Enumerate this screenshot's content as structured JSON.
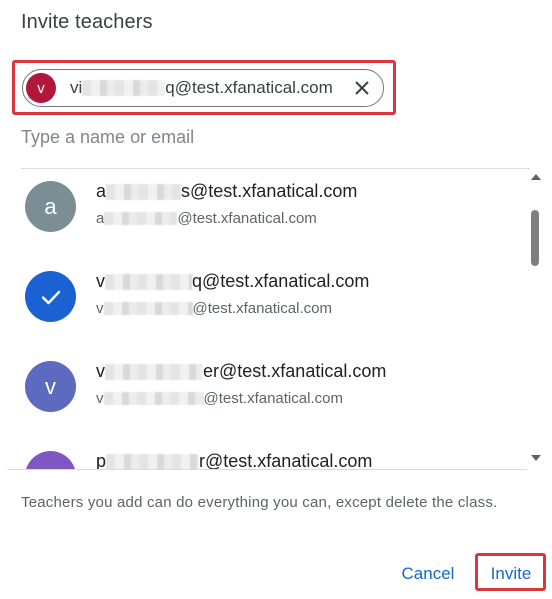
{
  "dialog": {
    "title": "Invite teachers"
  },
  "chip": {
    "avatar_letter": "v",
    "avatar_color": "#b0173b",
    "text_prefix": "vi",
    "text_suffix": "q@test.xfanatical.com",
    "close_icon": "close-icon"
  },
  "search": {
    "placeholder": "Type a name or email",
    "value": ""
  },
  "list": [
    {
      "avatar_letter": "a",
      "avatar_color": "#7b8e96",
      "primary_prefix": "a",
      "primary_suffix": "s@test.xfanatical.com",
      "secondary_prefix": "a",
      "secondary_suffix": "@test.xfanatical.com",
      "selected": false
    },
    {
      "avatar_letter": "",
      "avatar_color": "#1a62d2",
      "primary_prefix": "v",
      "primary_suffix": "q@test.xfanatical.com",
      "secondary_prefix": "v",
      "secondary_suffix": "@test.xfanatical.com",
      "selected": true,
      "icon": "check-icon"
    },
    {
      "avatar_letter": "v",
      "avatar_color": "#5c6bc0",
      "primary_prefix": "v",
      "primary_suffix": "er@test.xfanatical.com",
      "secondary_prefix": "v",
      "secondary_suffix": "@test.xfanatical.com",
      "selected": false
    },
    {
      "avatar_letter": "p",
      "avatar_color": "#7e57c2",
      "primary_prefix": "p",
      "primary_suffix": "r@test.xfanatical.com",
      "secondary_prefix": "",
      "secondary_suffix": "",
      "selected": false
    }
  ],
  "footer": {
    "note": "Teachers you add can do everything you can, except delete the class.",
    "cancel_label": "Cancel",
    "invite_label": "Invite"
  },
  "colors": {
    "accent": "#1a67d2",
    "highlight": "#d9363e"
  }
}
